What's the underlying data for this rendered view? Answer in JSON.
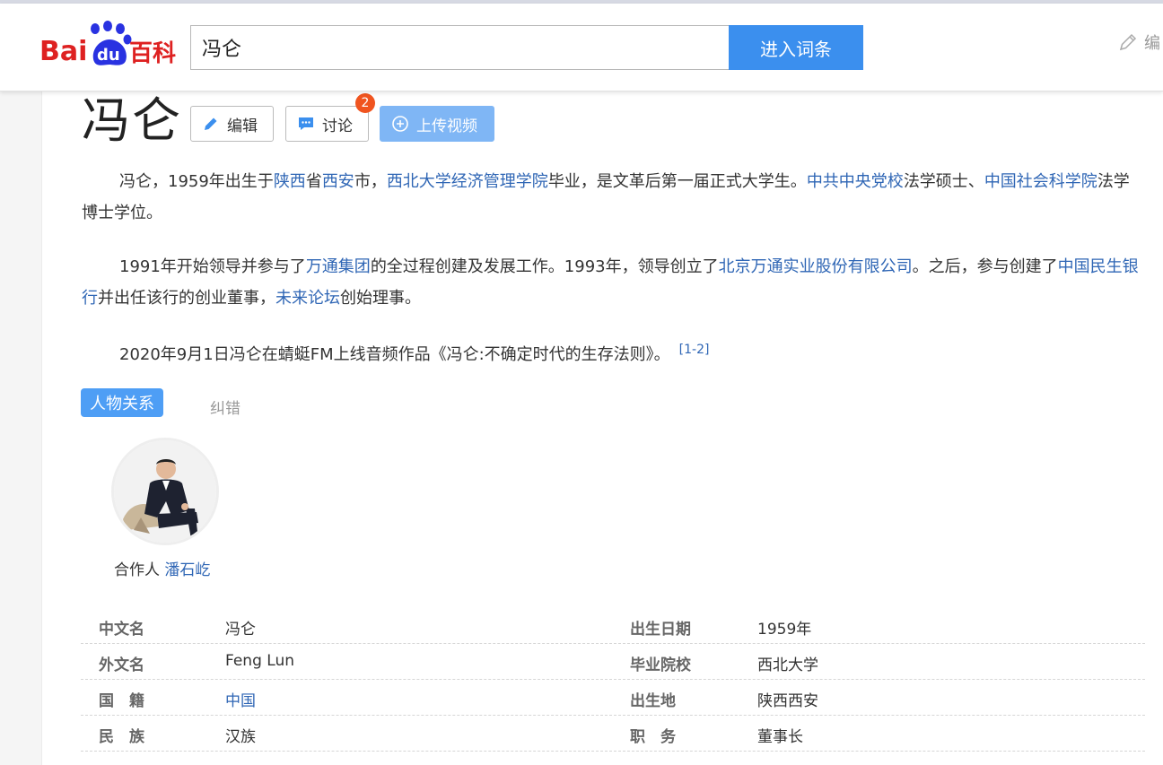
{
  "header": {
    "logo_text_left": "Bai",
    "logo_text_du": "du",
    "logo_text_right": "百科",
    "search_value": "冯仑",
    "search_button": "进入词条",
    "edit_label": "编"
  },
  "entry": {
    "title": "冯仑",
    "buttons": {
      "edit": "编辑",
      "discuss": "讨论",
      "discuss_badge": "2",
      "upload": "上传视频"
    },
    "p1": {
      "t1": "冯仑，1959年出生于",
      "l1": "陕西",
      "t2": "省",
      "l2": "西安",
      "t3": "市，",
      "l3": "西北大学经济管理学院",
      "t4": "毕业，是文革后第一届正式大学生。",
      "l4": "中共中央党校",
      "t5": "法学硕士、",
      "l5": "中国社会科学院",
      "t6": "法学博士学位。"
    },
    "p2": {
      "t1": "1991年开始领导并参与了",
      "l1": "万通集团",
      "t2": "的全过程创建及发展工作。1993年，领导创立了",
      "l2": "北京万通实业股份有限公司",
      "t3": "。之后，参与创建了",
      "l3": "中国民生银行",
      "t4": "并出任该行的创业董事，",
      "l4": "未来论坛",
      "t5": "创始理事。"
    },
    "p3": {
      "t1": "2020年9月1日冯仑在蜻蜓FM上线音频作品《冯仑:不确定时代的生存法则》。",
      "ref": "[1-2]"
    }
  },
  "relations": {
    "tab_label": "人物关系",
    "correct_label": "纠错",
    "person": {
      "relation": "合作人",
      "name": "潘石屹"
    }
  },
  "info": [
    {
      "lk": "中文名",
      "lv": "冯仑",
      "rk": "出生日期",
      "rv": "1959年"
    },
    {
      "lk": "外文名",
      "lv": "Feng Lun",
      "rk": "毕业院校",
      "rv": "西北大学"
    },
    {
      "lk": "国　籍",
      "lv": "中国",
      "rk": "出生地",
      "rv": "陕西西安"
    },
    {
      "lk": "民　族",
      "lv": "汉族",
      "rk": "职　务",
      "rv": "董事长"
    }
  ],
  "colors": {
    "accent": "#3b8fee",
    "link": "#2f66b5",
    "badge": "#f0541f",
    "logo_red": "#de2121",
    "logo_blue": "#2932e1"
  }
}
